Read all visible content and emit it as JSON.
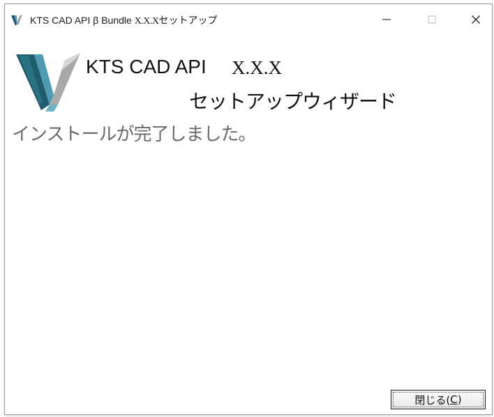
{
  "window": {
    "title_prefix": "KTS CAD API β Bundle ",
    "title_version": "X.X.X",
    "title_suffix": "セットアップ",
    "controls": {
      "minimize": "—",
      "maximize": "□",
      "close": "✕"
    }
  },
  "header": {
    "logo_icon": "kts-v-logo-icon",
    "product_name": "KTS CAD API",
    "product_version": "X.X.X",
    "wizard_title": "セットアップウィザード"
  },
  "body": {
    "message": "インストールが完了しました。"
  },
  "footer": {
    "close_label_prefix": "閉じる(",
    "close_label_accel": "C",
    "close_label_suffix": ")"
  },
  "colors": {
    "logo_dark": "#1f5c6e",
    "logo_mid": "#3f8ea3",
    "logo_light": "#8fc3d1",
    "logo_grey": "#b5b5b5",
    "message_text": "#6a6a6a"
  }
}
